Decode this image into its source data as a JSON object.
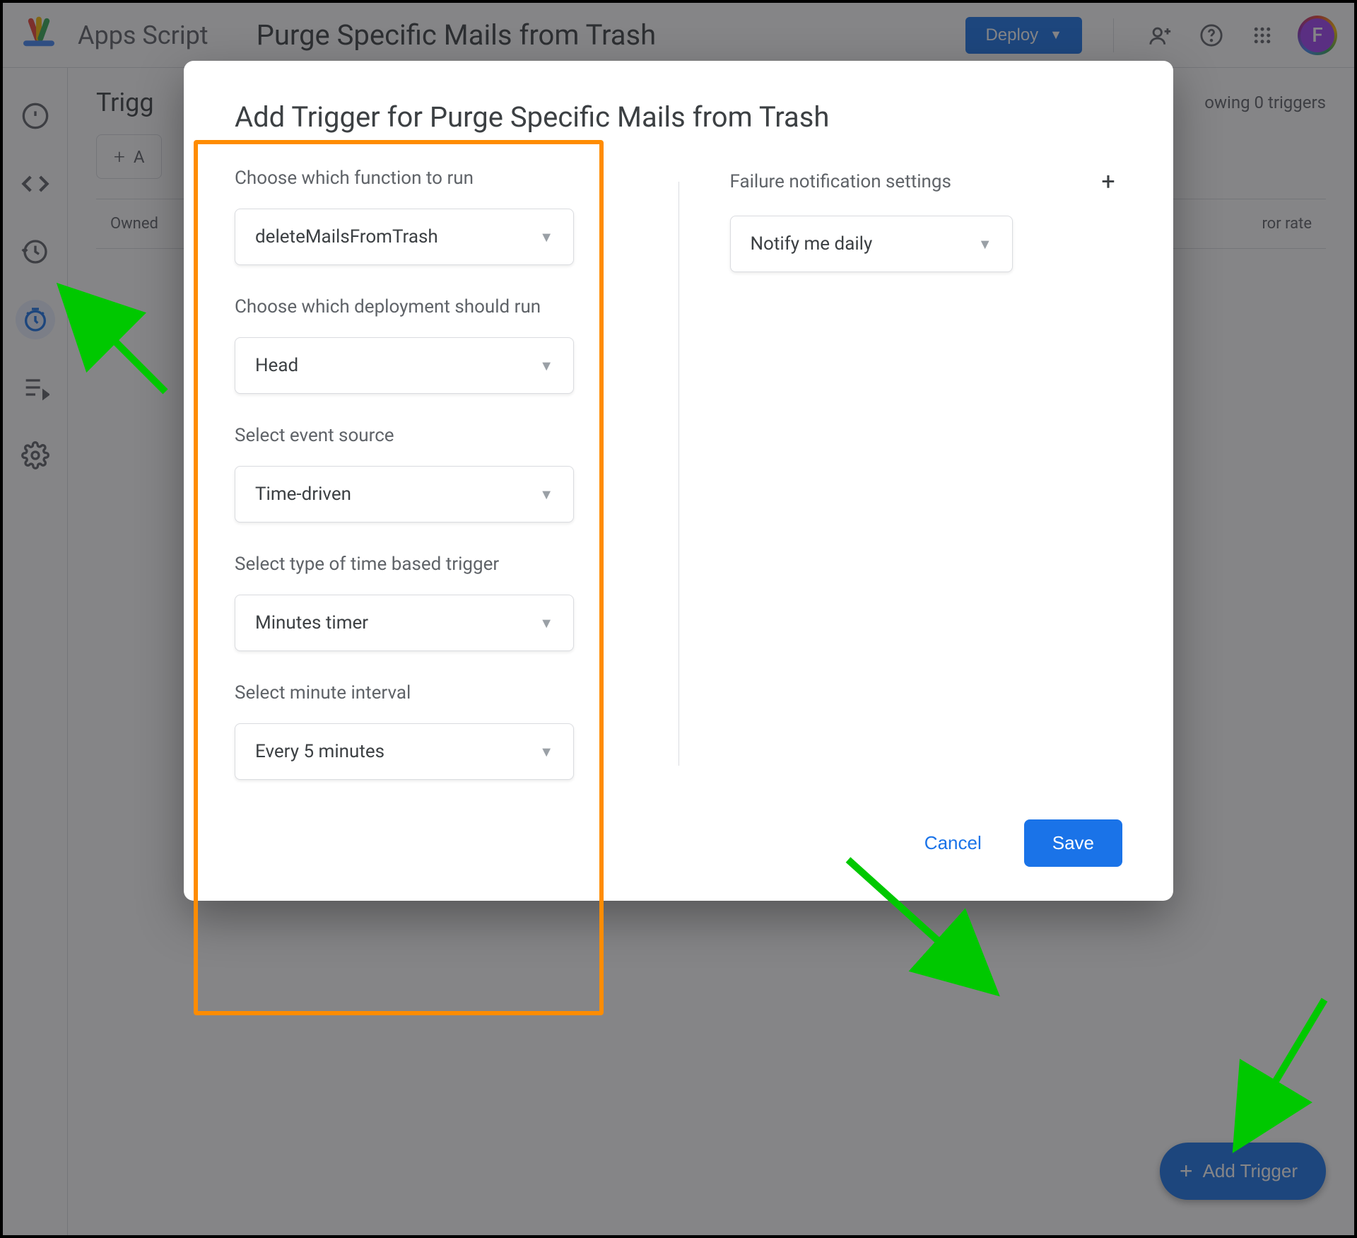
{
  "header": {
    "app_name": "Apps Script",
    "project_title": "Purge Specific Mails from Trash",
    "deploy_label": "Deploy",
    "avatar_letter": "F"
  },
  "page": {
    "title_prefix": "Trigg",
    "showing_label": "owing 0 triggers",
    "add_filter_label_fragment": "A",
    "columns": {
      "owned": "Owned",
      "error_rate_fragment": "ror rate"
    },
    "fab_label": "Add Trigger"
  },
  "dialog": {
    "title": "Add Trigger for Purge Specific Mails from Trash",
    "left": {
      "function_label": "Choose which function to run",
      "function_value": "deleteMailsFromTrash",
      "deployment_label": "Choose which deployment should run",
      "deployment_value": "Head",
      "source_label": "Select event source",
      "source_value": "Time-driven",
      "trigger_type_label": "Select type of time based trigger",
      "trigger_type_value": "Minutes timer",
      "interval_label": "Select minute interval",
      "interval_value": "Every 5 minutes"
    },
    "right": {
      "notif_label": "Failure notification settings",
      "notif_value": "Notify me daily"
    },
    "actions": {
      "cancel": "Cancel",
      "save": "Save"
    }
  },
  "annotations": {
    "highlight_color": "#ff8c00",
    "arrow_color": "#00c800"
  }
}
